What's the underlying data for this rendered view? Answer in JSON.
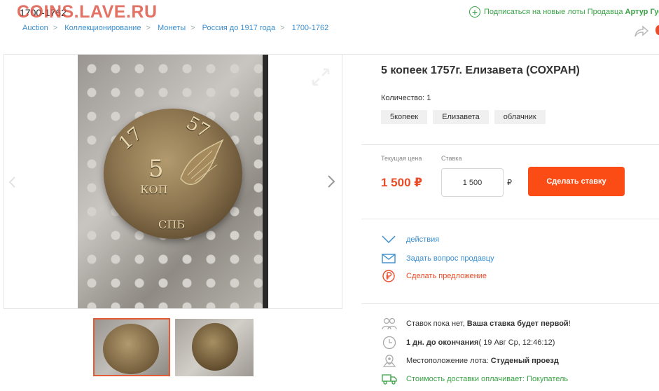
{
  "watermark": "COINS.LAVE.RU",
  "page_heading": "1700-1762",
  "breadcrumb": [
    "Auction",
    "Коллекционирование",
    "Монеты",
    "Россия до 1917 года",
    "1700-1762"
  ],
  "subscribe": {
    "text": "Подписаться на новые лоты Продавца",
    "seller": "Артур Гус"
  },
  "lot": {
    "title": "5 копеек 1757г. Елизавета (СОХРАН)",
    "quantity_label": "Количество:",
    "quantity": "1",
    "tags": [
      "5копеек",
      "Елизавета",
      "облачник"
    ]
  },
  "coin_stamp": {
    "year_left": "17",
    "year_right": "57",
    "value": "5",
    "unit": "КОП",
    "mint": "СПБ"
  },
  "pricing": {
    "current_price_label": "Текущая цена",
    "bid_label": "Ставка",
    "current_price": "1 500 ₽",
    "bid_value": "1 500",
    "currency": "₽",
    "bid_button": "Сделать ставку"
  },
  "actions": {
    "actions": "действия",
    "ask_seller": "Задать вопрос продавцу",
    "make_offer": "Сделать предложение"
  },
  "info": {
    "bids_plain": "Ставок пока нет, ",
    "bids_bold": "Ваша ставка будет первой",
    "bids_end": "!",
    "time_bold": "1 дн. до окончания",
    "time_rest": " ( 19 Авг Ср, 12:46:12)",
    "location_label": "Местоположение лота: ",
    "location": "Студеный проезд",
    "shipping": "Стоимость доставки оплачивает: Покупатель"
  },
  "colors": {
    "accent": "#fb4c16",
    "link": "#3a8fd0",
    "green": "#3aa344",
    "price": "#ea4b28"
  }
}
